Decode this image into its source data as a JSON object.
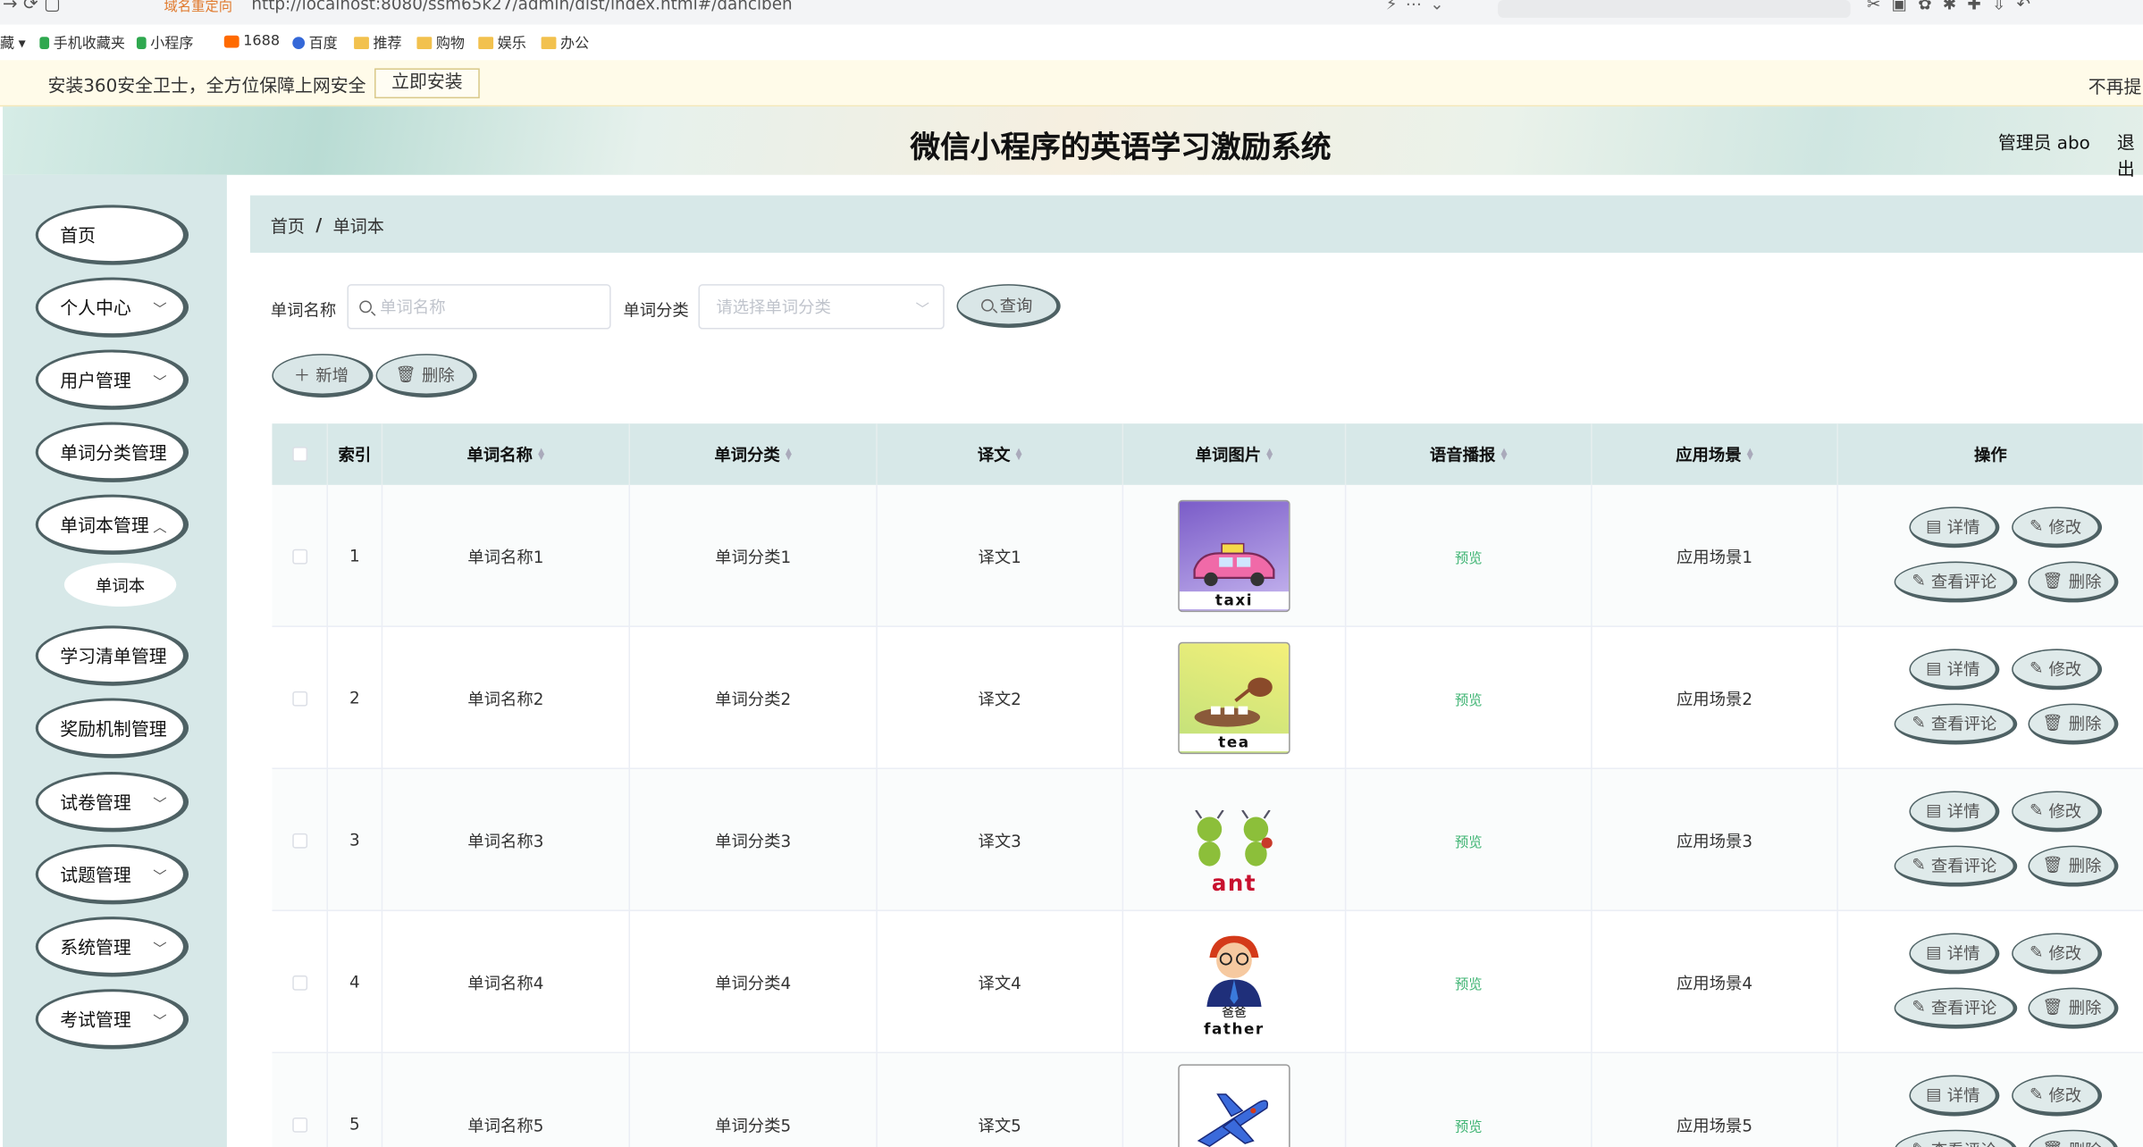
{
  "browser": {
    "redirect_tag": "域名重定向",
    "url": "http://localhost:8080/ssm65k27/admin/dist/index.html#/danciben",
    "bookmarks": [
      "藏",
      "手机收藏夹",
      "小程序",
      "1688",
      "百度",
      "推荐",
      "购物",
      "娱乐",
      "办公"
    ]
  },
  "notice": {
    "message": "安装360安全卫士，全方位保障上网安全",
    "install": "立即安装",
    "dismiss": "不再提"
  },
  "header": {
    "title": "微信小程序的英语学习激励系统",
    "user": "管理员 abo",
    "logout": "退出"
  },
  "sidebar": {
    "items": [
      {
        "label": "首页",
        "has_children": false
      },
      {
        "label": "个人中心",
        "has_children": true
      },
      {
        "label": "用户管理",
        "has_children": true
      },
      {
        "label": "单词分类管理",
        "has_children": true
      },
      {
        "label": "单词本管理",
        "has_children": true
      },
      {
        "label": "学习清单管理",
        "has_children": true
      },
      {
        "label": "奖励机制管理",
        "has_children": true
      },
      {
        "label": "试卷管理",
        "has_children": true
      },
      {
        "label": "试题管理",
        "has_children": true
      },
      {
        "label": "系统管理",
        "has_children": true
      },
      {
        "label": "考试管理",
        "has_children": true
      }
    ],
    "sub_item": "单词本"
  },
  "breadcrumb": {
    "home": "首页",
    "separator": "/",
    "current": "单词本"
  },
  "search": {
    "name_label": "单词名称",
    "name_placeholder": "单词名称",
    "category_label": "单词分类",
    "category_placeholder": "请选择单词分类",
    "query_button": "查询"
  },
  "actions": {
    "add": "新增",
    "delete": "删除"
  },
  "table": {
    "headers": [
      "索引",
      "单词名称",
      "单词分类",
      "译文",
      "单词图片",
      "语音播报",
      "应用场景",
      "操作"
    ],
    "rows": [
      {
        "index": "1",
        "name": "单词名称1",
        "category": "单词分类1",
        "translation": "译文1",
        "image_word": "taxi",
        "audio": "预览",
        "scene": "应用场景1"
      },
      {
        "index": "2",
        "name": "单词名称2",
        "category": "单词分类2",
        "translation": "译文2",
        "image_word": "tea",
        "audio": "预览",
        "scene": "应用场景2"
      },
      {
        "index": "3",
        "name": "单词名称3",
        "category": "单词分类3",
        "translation": "译文3",
        "image_word": "ant",
        "audio": "预览",
        "scene": "应用场景3"
      },
      {
        "index": "4",
        "name": "单词名称4",
        "category": "单词分类4",
        "translation": "译文4",
        "image_word": "father",
        "image_caption": "爸爸",
        "audio": "预览",
        "scene": "应用场景4"
      },
      {
        "index": "5",
        "name": "单词名称5",
        "category": "单词分类5",
        "translation": "译文5",
        "image_word": "",
        "audio": "预览",
        "scene": "应用场景5"
      }
    ],
    "row_buttons": {
      "detail": "详情",
      "edit": "修改",
      "comments": "查看评论",
      "delete": "删除"
    }
  },
  "colors": {
    "sidebar_bg": "#d7e8e8",
    "pill_border": "#4e6164",
    "preview_green": "#3cb371"
  }
}
